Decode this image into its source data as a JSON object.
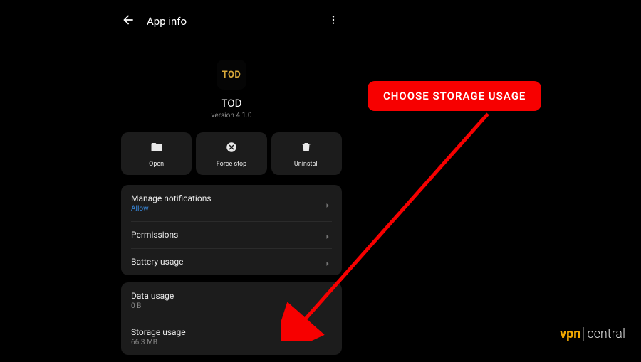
{
  "header": {
    "title": "App info"
  },
  "app": {
    "icon_text": "TOD",
    "name": "TOD",
    "version": "version 4.1.0"
  },
  "actions": {
    "open": "Open",
    "force_stop": "Force stop",
    "uninstall": "Uninstall"
  },
  "rows": {
    "notifications": {
      "label": "Manage notifications",
      "sub": "Allow"
    },
    "permissions": {
      "label": "Permissions"
    },
    "battery": {
      "label": "Battery usage"
    },
    "data": {
      "label": "Data usage",
      "sub": "0 B"
    },
    "storage": {
      "label": "Storage usage",
      "sub": "66.3 MB"
    }
  },
  "callout": {
    "text": "CHOOSE STORAGE USAGE"
  },
  "watermark": {
    "brand_left": "vpn",
    "brand_right": "central"
  }
}
